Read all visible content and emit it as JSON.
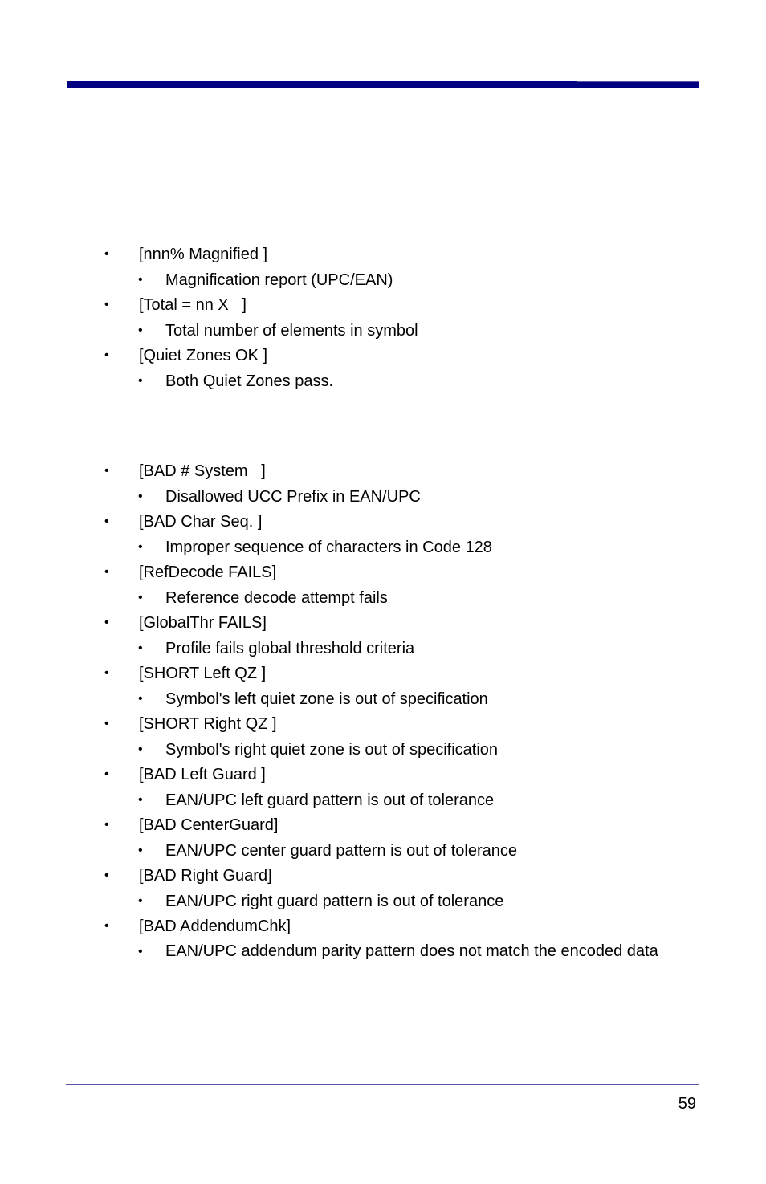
{
  "header": {
    "bar_color": "#000080"
  },
  "bullet_glyph": "•",
  "section_status": {
    "items": [
      {
        "code": "[nnn% Magnified ]",
        "description": "Magnification report (UPC/EAN)"
      },
      {
        "code": "[Total = nn X   ]",
        "description": "Total number of elements in symbol"
      },
      {
        "code": "[Quiet Zones OK ]",
        "description": "Both Quiet Zones pass."
      }
    ]
  },
  "section_errors": {
    "items": [
      {
        "code": "[BAD # System   ]",
        "description": "Disallowed UCC Prefix in EAN/UPC"
      },
      {
        "code": "[BAD Char Seq. ]",
        "description": "Improper sequence of characters in Code 128"
      },
      {
        "code": "[RefDecode FAILS]",
        "description": "Reference decode attempt fails"
      },
      {
        "code": "[GlobalThr FAILS]",
        "description": "Profile fails global threshold criteria"
      },
      {
        "code": "[SHORT Left QZ ]",
        "description": "Symbol's left quiet zone is out of specification"
      },
      {
        "code": "[SHORT Right QZ ]",
        "description": "Symbol's right quiet zone is out of specification"
      },
      {
        "code": "[BAD Left Guard ]",
        "description": "EAN/UPC left guard pattern is out of tolerance"
      },
      {
        "code": "[BAD CenterGuard]",
        "description": "EAN/UPC center guard pattern is out of tolerance"
      },
      {
        "code": "[BAD Right Guard]",
        "description": "EAN/UPC right guard pattern is out of tolerance"
      },
      {
        "code": "[BAD AddendumChk]",
        "description": "EAN/UPC addendum parity pattern does not match the encoded data"
      }
    ]
  },
  "footer": {
    "page_number": "59",
    "rule_color": "#5555a3"
  }
}
